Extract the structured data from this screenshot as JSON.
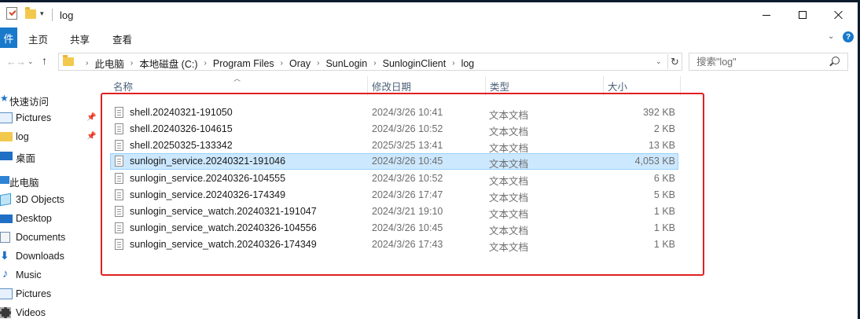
{
  "window": {
    "title": "log",
    "quick_access_dropdown": "▾"
  },
  "ribbon": {
    "file_tab": "件",
    "tabs": [
      {
        "label": "主页"
      },
      {
        "label": "共享"
      },
      {
        "label": "查看"
      }
    ],
    "collapse_chevron": "⌄",
    "help": "?"
  },
  "address": {
    "crumbs": [
      "此电脑",
      "本地磁盘 (C:)",
      "Program Files",
      "Oray",
      "SunLogin",
      "SunloginClient",
      "log"
    ],
    "dropdown": "⌄",
    "refresh": "↻"
  },
  "search": {
    "placeholder": "搜索\"log\""
  },
  "nav": {
    "items": [
      {
        "label": "快速访问",
        "icon": "star-icon"
      },
      {
        "label": "Pictures",
        "icon": "pictures-folder-icon",
        "pinned": true
      },
      {
        "label": "log",
        "icon": "folder-icon",
        "pinned": true
      },
      {
        "label": "桌面",
        "icon": "desktop-icon"
      },
      {
        "label": "此电脑",
        "icon": "computer-icon"
      },
      {
        "label": "3D Objects",
        "icon": "3d-objects-icon"
      },
      {
        "label": "Desktop",
        "icon": "desktop-icon"
      },
      {
        "label": "Documents",
        "icon": "documents-icon"
      },
      {
        "label": "Downloads",
        "icon": "downloads-icon"
      },
      {
        "label": "Music",
        "icon": "music-icon"
      },
      {
        "label": "Pictures",
        "icon": "pictures-folder-icon"
      },
      {
        "label": "Videos",
        "icon": "videos-icon"
      }
    ]
  },
  "columns": {
    "name": "名称",
    "date": "修改日期",
    "type": "类型",
    "size": "大小"
  },
  "files": [
    {
      "name": "shell.20240321-191050",
      "date": "2024/3/26 10:41",
      "type": "文本文档",
      "size": "392 KB"
    },
    {
      "name": "shell.20240326-104615",
      "date": "2024/3/26 10:52",
      "type": "文本文档",
      "size": "2 KB"
    },
    {
      "name": "shell.20250325-133342",
      "date": "2025/3/25 13:41",
      "type": "文本文档",
      "size": "13 KB"
    },
    {
      "name": "sunlogin_service.20240321-191046",
      "date": "2024/3/26 10:45",
      "type": "文本文档",
      "size": "4,053 KB"
    },
    {
      "name": "sunlogin_service.20240326-104555",
      "date": "2024/3/26 10:52",
      "type": "文本文档",
      "size": "6 KB"
    },
    {
      "name": "sunlogin_service.20240326-174349",
      "date": "2024/3/26 17:47",
      "type": "文本文档",
      "size": "5 KB"
    },
    {
      "name": "sunlogin_service_watch.20240321-191047",
      "date": "2024/3/21 19:10",
      "type": "文本文档",
      "size": "1 KB"
    },
    {
      "name": "sunlogin_service_watch.20240326-104556",
      "date": "2024/3/26 10:45",
      "type": "文本文档",
      "size": "1 KB"
    },
    {
      "name": "sunlogin_service_watch.20240326-174349",
      "date": "2024/3/26 17:43",
      "type": "文本文档",
      "size": "1 KB"
    }
  ],
  "selected_file_index": 3,
  "colors": {
    "accent": "#1979ca",
    "selection": "#cce8ff",
    "highlight_box": "#e02020"
  }
}
